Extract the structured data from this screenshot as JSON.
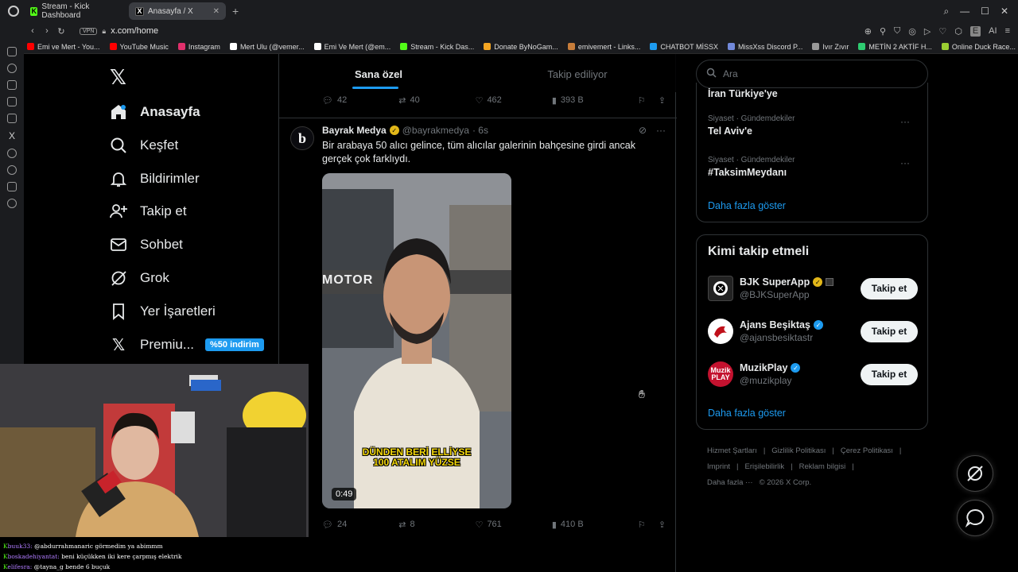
{
  "browser": {
    "tabs": [
      {
        "label": "Stream - Kick Dashboard",
        "icon": "kick-icon"
      },
      {
        "label": "Anasayfa / X",
        "icon": "x-icon"
      }
    ],
    "vpn_label": "VPN",
    "url": "x.com/home",
    "ai_label": "AI",
    "bookmarks": [
      {
        "label": "Emi ve Mert - You...",
        "color": "#ff0000"
      },
      {
        "label": "YouTube Music",
        "color": "#ff0000"
      },
      {
        "label": "Instagram",
        "color": "#e1306c"
      },
      {
        "label": "Mert Ulu (@vemer...",
        "color": "#ffffff"
      },
      {
        "label": "Emi Ve Mert (@em...",
        "color": "#ffffff"
      },
      {
        "label": "Stream - Kick Das...",
        "color": "#53fc18"
      },
      {
        "label": "Donate ByNoGam...",
        "color": "#f5a623"
      },
      {
        "label": "emivemert - Links...",
        "color": "#c77d3a"
      },
      {
        "label": "CHATBOT MİSSX",
        "color": "#1d9bf0"
      },
      {
        "label": "MissXss Discord P...",
        "color": "#7289da"
      },
      {
        "label": "Ivır Zıvır",
        "color": "#999999"
      },
      {
        "label": "METİN 2 AKTİF H...",
        "color": "#2ecc71"
      },
      {
        "label": "Online Duck Race...",
        "color": "#9acd32"
      }
    ]
  },
  "nav": {
    "items": [
      {
        "label": "Anasayfa",
        "icon": "home-icon"
      },
      {
        "label": "Keşfet",
        "icon": "search-icon"
      },
      {
        "label": "Bildirimler",
        "icon": "bell-icon"
      },
      {
        "label": "Takip et",
        "icon": "follow-icon"
      },
      {
        "label": "Sohbet",
        "icon": "mail-icon"
      },
      {
        "label": "Grok",
        "icon": "grok-icon"
      },
      {
        "label": "Yer İşaretleri",
        "icon": "bookmark-icon"
      },
      {
        "label": "Premiu...",
        "icon": "x-premium-icon"
      }
    ],
    "premium_badge": "%50 indirim"
  },
  "feed": {
    "tabs": [
      "Sana özel",
      "Takip ediliyor"
    ],
    "prev_post_stats": {
      "replies": "42",
      "reposts": "40",
      "likes": "462",
      "views": "393 B"
    },
    "post": {
      "name": "Bayrak Medya",
      "handle": "@bayrakmedya",
      "time": "· 6s",
      "text": "Bir arabaya 50 alıcı gelince, tüm alıcılar galerinin bahçesine girdi ancak gerçek çok farklıydı.",
      "video_duration": "0:49",
      "video_caption_line1": "DÜNDEN BERİ ELLİYSE",
      "video_caption_line2": "100 ATALIM YÜZSE",
      "storefront": "MOTOR",
      "stats": {
        "replies": "24",
        "reposts": "8",
        "likes": "761",
        "views": "410 B"
      }
    }
  },
  "right": {
    "search_placeholder": "Ara",
    "trends_top_partial": "İran Türkiye'ye",
    "trends": [
      {
        "category": "Siyaset · Gündemdekiler",
        "name": "Tel Aviv'e"
      },
      {
        "category": "Siyaset · Gündemdekiler",
        "name": "#TaksimMeydanı"
      }
    ],
    "show_more": "Daha fazla göster",
    "who_title": "Kimi takip etmeli",
    "who": [
      {
        "name": "BJK SuperApp",
        "handle": "@BJKSuperApp",
        "check": "gold",
        "button": "Takip et"
      },
      {
        "name": "Ajans Beşiktaş",
        "handle": "@ajansbesiktastr",
        "check": "blue",
        "button": "Takip et"
      },
      {
        "name": "MuzikPlay",
        "handle": "@muzikplay",
        "check": "blue",
        "button": "Takip et"
      }
    ],
    "who_avatar_label_muzik": "Muzik PLAY",
    "who_show_more": "Daha fazla göster",
    "footer": [
      "Hizmet Şartları",
      "|",
      "Gizlilik Politikası",
      "|",
      "Çerez Politikası",
      "|",
      "Imprint",
      "|",
      "Erişilebilirlik",
      "|",
      "Reklam bilgisi",
      "|",
      "Daha fazla ···",
      "© 2026 X Corp."
    ]
  },
  "chat": [
    {
      "user": "buuk33:",
      "msg": "@abdurrahmanaric görmedim ya abimmm"
    },
    {
      "user": "boskadehiyantat:",
      "msg": "beni küçükken iki kere çarpmış elektrik"
    },
    {
      "user": "elifesra:",
      "msg": "@tayna_g bende 6 buçuk"
    }
  ]
}
